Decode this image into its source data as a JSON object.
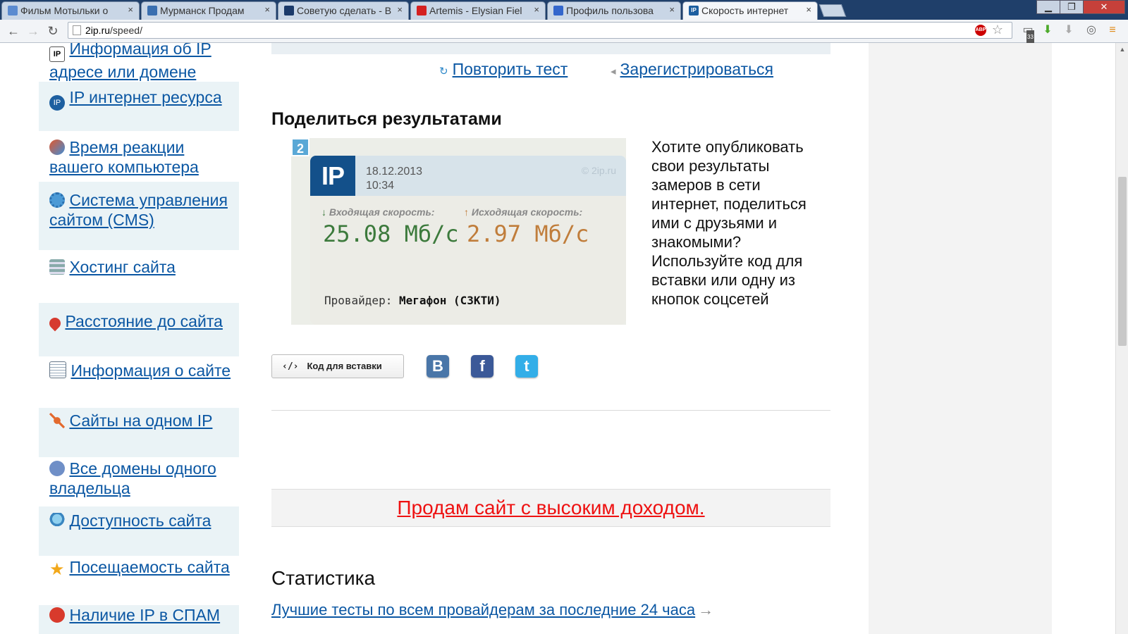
{
  "browser": {
    "tabs": [
      {
        "title": "Фильм Мотыльки о",
        "icon": "film-icon",
        "color": "#5b8bd0"
      },
      {
        "title": "Мурманск Продам",
        "icon": "avito-icon",
        "color": "#3a6fb0"
      },
      {
        "title": "Советую сделать - В",
        "icon": "eye-icon",
        "color": "#1b3a6a"
      },
      {
        "title": "Artemis - Elysian Fiel",
        "icon": "youtube-icon",
        "color": "#d42020"
      },
      {
        "title": "Профиль пользова",
        "icon": "sync-icon",
        "color": "#3366cc"
      },
      {
        "title": "Скорость интернет",
        "icon": "ip-icon",
        "color": "#1d5fa0"
      }
    ],
    "url_host": "2ip.ru",
    "url_path": "/speed/",
    "adblock_label": "ABP",
    "extension_badge": "33",
    "close_glyph": "×",
    "window_buttons": {
      "minimize": "▁",
      "maximize": "❐",
      "close": "✕"
    }
  },
  "sidebar": {
    "items": [
      {
        "label": "Информация об IP адресе или домене",
        "icon": "ip-info-icon"
      },
      {
        "label": "IP интернет ресурса",
        "icon": "ip-globe-icon"
      },
      {
        "label": "Время реакции вашего компьютера",
        "icon": "reaction-time-icon"
      },
      {
        "label": "Система управления сайтом (CMS)",
        "icon": "cms-gear-icon"
      },
      {
        "label": "Хостинг сайта",
        "icon": "hosting-server-icon"
      },
      {
        "label": "Расстояние до сайта",
        "icon": "map-pin-icon"
      },
      {
        "label": "Информация о сайте",
        "icon": "document-icon"
      },
      {
        "label": "Сайты на одном IP",
        "icon": "network-icon"
      },
      {
        "label": "Все домены одного владельца",
        "icon": "owner-icon"
      },
      {
        "label": "Доступность сайта",
        "icon": "availability-icon"
      },
      {
        "label": "Посещаемость сайта",
        "icon": "star-icon"
      },
      {
        "label": "Наличие IP в СПАМ",
        "icon": "spam-icon"
      }
    ]
  },
  "actions": {
    "retry": "Повторить тест",
    "register": "Зарегистрироваться"
  },
  "share": {
    "heading": "Поделиться результатами",
    "badge_number": "2",
    "card": {
      "logo": "IP",
      "date": "18.12.2013",
      "time": "10:34",
      "copyright": "© 2ip.ru",
      "download_label": "Входящая скорость:",
      "download_value": "25.08 Мб/с",
      "upload_label": "Исходящая скорость:",
      "upload_value": "2.97 Мб/с",
      "provider_label": "Провайдер:",
      "provider_value": "Мегафон (СЗКТИ)"
    },
    "description": "Хотите опубликовать свои результаты замеров в сети интернет, поделиться ими с друзьями и знакомыми? Используйте код для вставки или одну из кнопок соцсетей",
    "embed_button": "Код для вставки",
    "embed_icon_text": "‹/›",
    "social": [
      {
        "name": "vk",
        "glyph": "B",
        "color": "#4a76a8"
      },
      {
        "name": "facebook",
        "glyph": "f",
        "color": "#3b5998"
      },
      {
        "name": "twitter",
        "glyph": "t",
        "color": "#33aee8"
      }
    ]
  },
  "ad": {
    "text": "Продам сайт с высоким доходом."
  },
  "stats": {
    "heading": "Статистика",
    "link": "Лучшие тесты по всем провайдерам за последние 24 часа"
  },
  "colors": {
    "link": "#0b57a3",
    "download": "#3c7a3c",
    "upload": "#c07d3b",
    "ad": "#e11111"
  }
}
